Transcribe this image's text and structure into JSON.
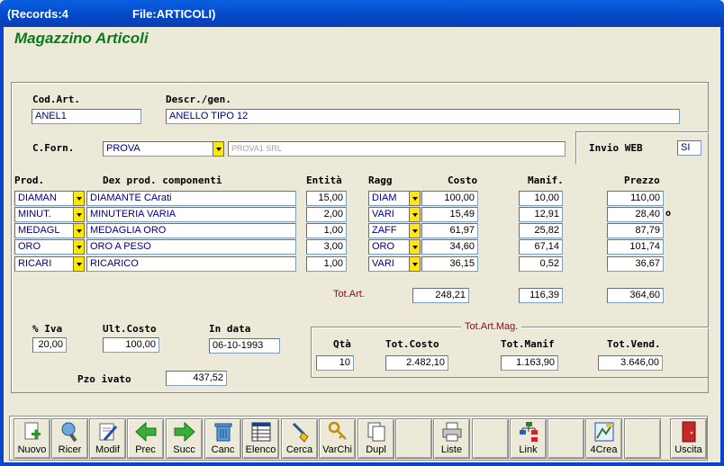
{
  "window": {
    "records": "(Records:4",
    "file": "File:ARTICOLI)"
  },
  "header": {
    "title": "Magazzino Articoli"
  },
  "form": {
    "cod_art_label": "Cod.Art.",
    "cod_art_value": "ANEL1",
    "descr_label": "Descr./gen.",
    "descr_value": "ANELLO TIPO 12",
    "fornitore_label": "C.Forn.",
    "fornitore_value": "PROVA",
    "fornitore_name": "PROVA1 SRL",
    "invio_web_label": "Invio WEB",
    "invio_web_value": "SI"
  },
  "components": {
    "headers": {
      "prod": "Prod.",
      "dex": "Dex prod. componenti",
      "entita": "Entità",
      "ragg": "Ragg",
      "costo": "Costo",
      "manif": "Manif.",
      "prezzo": "Prezzo"
    },
    "rows": [
      {
        "prod": "DIAMAN",
        "dex": "DIAMANTE CArati",
        "entita": "15,00",
        "ragg": "DIAM",
        "costo": "100,00",
        "manif": "10,00",
        "prezzo": "110,00",
        "flag": ""
      },
      {
        "prod": "MINUT.",
        "dex": "MINUTERIA VARIA",
        "entita": "2,00",
        "ragg": "VARI",
        "costo": "15,49",
        "manif": "12,91",
        "prezzo": "28,40",
        "flag": "o"
      },
      {
        "prod": "MEDAGL",
        "dex": "MEDAGLIA ORO",
        "entita": "1,00",
        "ragg": "ZAFF",
        "costo": "61,97",
        "manif": "25,82",
        "prezzo": "87,79",
        "flag": ""
      },
      {
        "prod": "ORO",
        "dex": "ORO A PESO",
        "entita": "3,00",
        "ragg": "ORO",
        "costo": "34,60",
        "manif": "67,14",
        "prezzo": "101,74",
        "flag": ""
      },
      {
        "prod": "RICARI",
        "dex": "RICARICO",
        "entita": "1,00",
        "ragg": "VARI",
        "costo": "36,15",
        "manif": "0,52",
        "prezzo": "36,67",
        "flag": ""
      }
    ],
    "tot_label": "Tot.Art.",
    "tot_costo": "248,21",
    "tot_manif": "116,39",
    "tot_prezzo": "364,60"
  },
  "summary": {
    "iva_label": "% Iva",
    "iva_value": "20,00",
    "ult_costo_label": "Ult.Costo",
    "ult_costo_value": "100,00",
    "in_data_label": "In data",
    "in_data_value": "06-10-1993",
    "pzo_ivato_label": "Pzo ivato",
    "pzo_ivato_value": "437,52"
  },
  "magazzino": {
    "title": "Tot.Art.Mag.",
    "qta_label": "Qtà",
    "qta_value": "10",
    "tot_costo_label": "Tot.Costo",
    "tot_costo_value": "2.482,10",
    "tot_manif_label": "Tot.Manif",
    "tot_manif_value": "1.163,90",
    "tot_vend_label": "Tot.Vend.",
    "tot_vend_value": "3.646,00"
  },
  "toolbar": {
    "nuovo": "Nuovo",
    "ricer": "Ricer",
    "modif": "Modif",
    "prec": "Prec",
    "succ": "Succ",
    "canc": "Canc",
    "elenco": "Elenco",
    "cerca": "Cerca",
    "varchi": "VarChi",
    "dupl": "Dupl",
    "liste": "Liste",
    "link": "Link",
    "crea": "4Crea",
    "uscita": "Uscita"
  },
  "icons": [
    "add-doc-icon",
    "search-globe-icon",
    "edit-doc-icon",
    "arrow-left-icon",
    "arrow-right-icon",
    "trash-icon",
    "list-icon",
    "brush-icon",
    "keys-icon",
    "copy-icon",
    "printer-icon",
    "tree-icon",
    "build-icon",
    "exit-door-icon"
  ],
  "colors": {
    "title_green": "#0A7A1A",
    "dropdown_yellow": "#FFE800",
    "titlebar_blue": "#0A50D8",
    "accent_red": "#7A1010"
  }
}
